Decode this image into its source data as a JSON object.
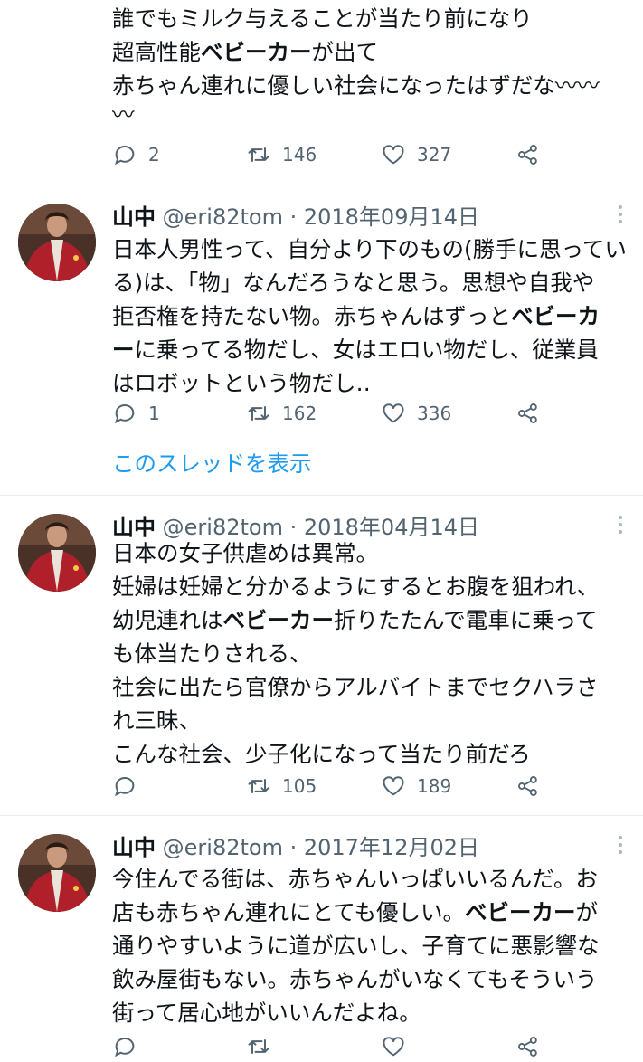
{
  "theme": {
    "accent": "#1d9bf0",
    "muted": "#536471",
    "text": "#0f1419",
    "divider": "#e6ecf0"
  },
  "top_tweet": {
    "lines": [
      {
        "pre": "誰でもミルク与えることが当たり前になり",
        "hl": "",
        "post": ""
      },
      {
        "pre": "超高性能",
        "hl": "ベビーカー",
        "post": "が出て"
      },
      {
        "pre": "赤ちゃん連れに優しい社会になったはずだな〰〰",
        "hl": "",
        "post": ""
      },
      {
        "pre": "〰",
        "hl": "",
        "post": ""
      }
    ],
    "replies": "2",
    "retweets": "146",
    "likes": "327"
  },
  "tweets": [
    {
      "name": "山中",
      "handle": "@eri82tom",
      "sep": " · ",
      "date": "2018年09月14日",
      "lines": [
        {
          "pre": "日本人男性って、自分より下のもの(勝手に思ってい",
          "hl": "",
          "post": ""
        },
        {
          "pre": "る)は、「物」なんだろうなと思う。思想や自我や",
          "hl": "",
          "post": ""
        },
        {
          "pre": "拒否権を持たない物。赤ちゃんはずっと",
          "hl": "ベビーカ",
          "post": ""
        },
        {
          "pre": "",
          "hl": "ー",
          "post": "に乗ってる物だし、女はエロい物だし、従業員"
        },
        {
          "pre": "はロボットという物だし‥",
          "hl": "",
          "post": ""
        }
      ],
      "replies": "1",
      "retweets": "162",
      "likes": "336",
      "show_thread": "このスレッドを表示"
    },
    {
      "name": "山中",
      "handle": "@eri82tom",
      "sep": " · ",
      "date": "2018年04月14日",
      "lines": [
        {
          "pre": "日本の女子供虐めは異常。",
          "hl": "",
          "post": ""
        },
        {
          "pre": "妊婦は妊婦と分かるようにするとお腹を狙われ、",
          "hl": "",
          "post": ""
        },
        {
          "pre": "幼児連れは",
          "hl": "ベビーカー",
          "post": "折りたたんで電車に乗って"
        },
        {
          "pre": "も体当たりされる、",
          "hl": "",
          "post": ""
        },
        {
          "pre": "社会に出たら官僚からアルバイトまでセクハラさ",
          "hl": "",
          "post": ""
        },
        {
          "pre": "れ三昧、",
          "hl": "",
          "post": ""
        },
        {
          "pre": "こんな社会、少子化になって当たり前だろ",
          "hl": "",
          "post": ""
        }
      ],
      "replies": "",
      "retweets": "105",
      "likes": "189"
    },
    {
      "name": "山中",
      "handle": "@eri82tom",
      "sep": " · ",
      "date": "2017年12月02日",
      "lines": [
        {
          "pre": "今住んでる街は、赤ちゃんいっぱいいるんだ。お",
          "hl": "",
          "post": ""
        },
        {
          "pre": "店も赤ちゃん連れにとても優しい。",
          "hl": "ベビーカー",
          "post": "が"
        },
        {
          "pre": "通りやすいように道が広いし、子育てに悪影響な",
          "hl": "",
          "post": ""
        },
        {
          "pre": "飲み屋街もない。赤ちゃんがいなくてもそういう",
          "hl": "",
          "post": ""
        },
        {
          "pre": "街って居心地がいいんだよね。",
          "hl": "",
          "post": ""
        }
      ],
      "replies": "",
      "retweets": "",
      "likes": ""
    }
  ]
}
